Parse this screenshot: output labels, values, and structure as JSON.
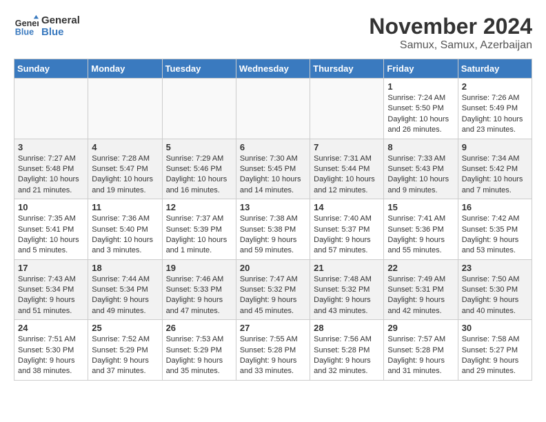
{
  "logo": {
    "line1": "General",
    "line2": "Blue"
  },
  "title": "November 2024",
  "location": "Samux, Samux, Azerbaijan",
  "days_of_week": [
    "Sunday",
    "Monday",
    "Tuesday",
    "Wednesday",
    "Thursday",
    "Friday",
    "Saturday"
  ],
  "weeks": [
    [
      {
        "num": "",
        "info": ""
      },
      {
        "num": "",
        "info": ""
      },
      {
        "num": "",
        "info": ""
      },
      {
        "num": "",
        "info": ""
      },
      {
        "num": "",
        "info": ""
      },
      {
        "num": "1",
        "info": "Sunrise: 7:24 AM\nSunset: 5:50 PM\nDaylight: 10 hours and 26 minutes."
      },
      {
        "num": "2",
        "info": "Sunrise: 7:26 AM\nSunset: 5:49 PM\nDaylight: 10 hours and 23 minutes."
      }
    ],
    [
      {
        "num": "3",
        "info": "Sunrise: 7:27 AM\nSunset: 5:48 PM\nDaylight: 10 hours and 21 minutes."
      },
      {
        "num": "4",
        "info": "Sunrise: 7:28 AM\nSunset: 5:47 PM\nDaylight: 10 hours and 19 minutes."
      },
      {
        "num": "5",
        "info": "Sunrise: 7:29 AM\nSunset: 5:46 PM\nDaylight: 10 hours and 16 minutes."
      },
      {
        "num": "6",
        "info": "Sunrise: 7:30 AM\nSunset: 5:45 PM\nDaylight: 10 hours and 14 minutes."
      },
      {
        "num": "7",
        "info": "Sunrise: 7:31 AM\nSunset: 5:44 PM\nDaylight: 10 hours and 12 minutes."
      },
      {
        "num": "8",
        "info": "Sunrise: 7:33 AM\nSunset: 5:43 PM\nDaylight: 10 hours and 9 minutes."
      },
      {
        "num": "9",
        "info": "Sunrise: 7:34 AM\nSunset: 5:42 PM\nDaylight: 10 hours and 7 minutes."
      }
    ],
    [
      {
        "num": "10",
        "info": "Sunrise: 7:35 AM\nSunset: 5:41 PM\nDaylight: 10 hours and 5 minutes."
      },
      {
        "num": "11",
        "info": "Sunrise: 7:36 AM\nSunset: 5:40 PM\nDaylight: 10 hours and 3 minutes."
      },
      {
        "num": "12",
        "info": "Sunrise: 7:37 AM\nSunset: 5:39 PM\nDaylight: 10 hours and 1 minute."
      },
      {
        "num": "13",
        "info": "Sunrise: 7:38 AM\nSunset: 5:38 PM\nDaylight: 9 hours and 59 minutes."
      },
      {
        "num": "14",
        "info": "Sunrise: 7:40 AM\nSunset: 5:37 PM\nDaylight: 9 hours and 57 minutes."
      },
      {
        "num": "15",
        "info": "Sunrise: 7:41 AM\nSunset: 5:36 PM\nDaylight: 9 hours and 55 minutes."
      },
      {
        "num": "16",
        "info": "Sunrise: 7:42 AM\nSunset: 5:35 PM\nDaylight: 9 hours and 53 minutes."
      }
    ],
    [
      {
        "num": "17",
        "info": "Sunrise: 7:43 AM\nSunset: 5:34 PM\nDaylight: 9 hours and 51 minutes."
      },
      {
        "num": "18",
        "info": "Sunrise: 7:44 AM\nSunset: 5:34 PM\nDaylight: 9 hours and 49 minutes."
      },
      {
        "num": "19",
        "info": "Sunrise: 7:46 AM\nSunset: 5:33 PM\nDaylight: 9 hours and 47 minutes."
      },
      {
        "num": "20",
        "info": "Sunrise: 7:47 AM\nSunset: 5:32 PM\nDaylight: 9 hours and 45 minutes."
      },
      {
        "num": "21",
        "info": "Sunrise: 7:48 AM\nSunset: 5:32 PM\nDaylight: 9 hours and 43 minutes."
      },
      {
        "num": "22",
        "info": "Sunrise: 7:49 AM\nSunset: 5:31 PM\nDaylight: 9 hours and 42 minutes."
      },
      {
        "num": "23",
        "info": "Sunrise: 7:50 AM\nSunset: 5:30 PM\nDaylight: 9 hours and 40 minutes."
      }
    ],
    [
      {
        "num": "24",
        "info": "Sunrise: 7:51 AM\nSunset: 5:30 PM\nDaylight: 9 hours and 38 minutes."
      },
      {
        "num": "25",
        "info": "Sunrise: 7:52 AM\nSunset: 5:29 PM\nDaylight: 9 hours and 37 minutes."
      },
      {
        "num": "26",
        "info": "Sunrise: 7:53 AM\nSunset: 5:29 PM\nDaylight: 9 hours and 35 minutes."
      },
      {
        "num": "27",
        "info": "Sunrise: 7:55 AM\nSunset: 5:28 PM\nDaylight: 9 hours and 33 minutes."
      },
      {
        "num": "28",
        "info": "Sunrise: 7:56 AM\nSunset: 5:28 PM\nDaylight: 9 hours and 32 minutes."
      },
      {
        "num": "29",
        "info": "Sunrise: 7:57 AM\nSunset: 5:28 PM\nDaylight: 9 hours and 31 minutes."
      },
      {
        "num": "30",
        "info": "Sunrise: 7:58 AM\nSunset: 5:27 PM\nDaylight: 9 hours and 29 minutes."
      }
    ]
  ]
}
